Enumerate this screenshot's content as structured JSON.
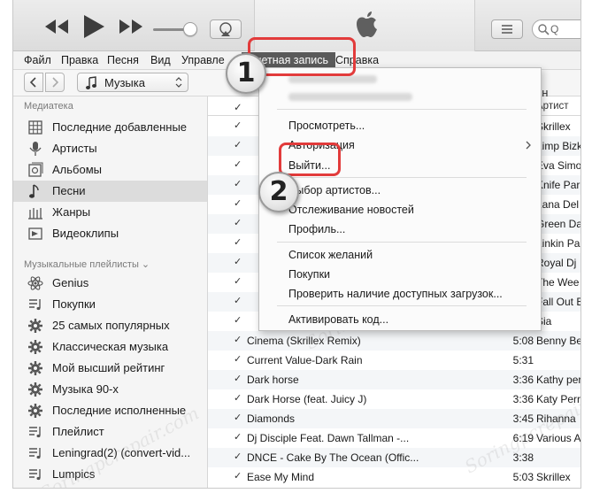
{
  "menubar": {
    "items": [
      "Файл",
      "Правка",
      "Песня",
      "Вид",
      "Управле"
    ],
    "account": "Учетная запись",
    "help": "Справка"
  },
  "toolbar": {
    "library_select": "Музыка",
    "search_placeholder": "Q"
  },
  "sidebar": {
    "library_header": "Медиатека",
    "library_items": [
      {
        "label": "Последние добавленные",
        "icon": "grid-icon"
      },
      {
        "label": "Артисты",
        "icon": "microphone-icon"
      },
      {
        "label": "Альбомы",
        "icon": "album-icon"
      },
      {
        "label": "Песни",
        "icon": "music-note-icon",
        "selected": true
      },
      {
        "label": "Жанры",
        "icon": "genres-icon"
      },
      {
        "label": "Видеоклипы",
        "icon": "video-icon"
      }
    ],
    "playlists_header": "Музыкальные плейлисты ⌄",
    "playlist_items": [
      {
        "label": "Genius",
        "icon": "atom-icon"
      },
      {
        "label": "Покупки",
        "icon": "playlist-icon"
      },
      {
        "label": "25 самых популярных",
        "icon": "gear-icon"
      },
      {
        "label": "Классическая музыка",
        "icon": "gear-icon"
      },
      {
        "label": "Мой высший рейтинг",
        "icon": "gear-icon"
      },
      {
        "label": "Музыка 90-х",
        "icon": "gear-icon"
      },
      {
        "label": "Последние исполненные",
        "icon": "gear-icon"
      },
      {
        "label": "Плейлист",
        "icon": "playlist-icon"
      },
      {
        "label": "Leningrad(2)  (convert-vid...",
        "icon": "playlist-icon"
      },
      {
        "label": "Lumpics",
        "icon": "playlist-icon"
      }
    ]
  },
  "songlist": {
    "header_check": "✓",
    "header_name_tail": "азин",
    "header_artist": "Артист",
    "rows": [
      {
        "name": "",
        "time": "",
        "artist": "Skrillex"
      },
      {
        "name": "",
        "time": "",
        "artist": "Limp Bizk"
      },
      {
        "name": "",
        "time": "",
        "artist": "Eva Simo"
      },
      {
        "name": "",
        "time": "",
        "artist": "Knife Par"
      },
      {
        "name": "",
        "time": "",
        "artist": "Lana Del"
      },
      {
        "name": "",
        "time": "",
        "artist": "Green Da"
      },
      {
        "name": "",
        "time": "",
        "artist": "Linkin Pa"
      },
      {
        "name": "",
        "time": "",
        "artist": "Royal Dj"
      },
      {
        "name": "",
        "time": "",
        "artist": "The Wee"
      },
      {
        "name": "",
        "time": "",
        "artist": "Fall Out B"
      },
      {
        "name": "",
        "time": "",
        "artist": "Sia"
      },
      {
        "name": "Cinema (Skrillex Remix)",
        "time": "5:08",
        "artist": "Benny Be"
      },
      {
        "name": "Current Value-Dark Rain",
        "time": "5:31",
        "artist": ""
      },
      {
        "name": "Dark horse",
        "time": "3:36",
        "artist": "Kathy per"
      },
      {
        "name": "Dark Horse (feat. Juicy J)",
        "time": "3:36",
        "artist": "Katy Perr"
      },
      {
        "name": "Diamonds",
        "time": "3:45",
        "artist": "Rihanna"
      },
      {
        "name": "Dj Disciple Feat. Dawn Tallman -...",
        "time": "6:19",
        "artist": "Various A"
      },
      {
        "name": "DNCE - Cake By The Ocean (Offic...",
        "time": "3:38",
        "artist": ""
      },
      {
        "name": "Ease My Mind",
        "time": "5:03",
        "artist": "Skrillex"
      }
    ]
  },
  "account_menu": {
    "items": [
      {
        "label": "Просмотреть..."
      },
      {
        "label": "Авторизация"
      },
      {
        "label": "Выйти..."
      },
      {
        "label": "Выбор артистов..."
      },
      {
        "label": "Отслеживание новостей"
      },
      {
        "label": "Профиль..."
      },
      {
        "label": "Список желаний"
      },
      {
        "label": "Покупки"
      },
      {
        "label": "Проверить наличие доступных загрузок..."
      },
      {
        "label": "Активировать код..."
      }
    ]
  },
  "annotations": {
    "badge_1": "1",
    "badge_2": "2"
  },
  "watermark": "Soringpcrepair.com",
  "colors": {
    "annotation_red": "#e23b3b",
    "menu_highlight": "#5a5a5a"
  }
}
